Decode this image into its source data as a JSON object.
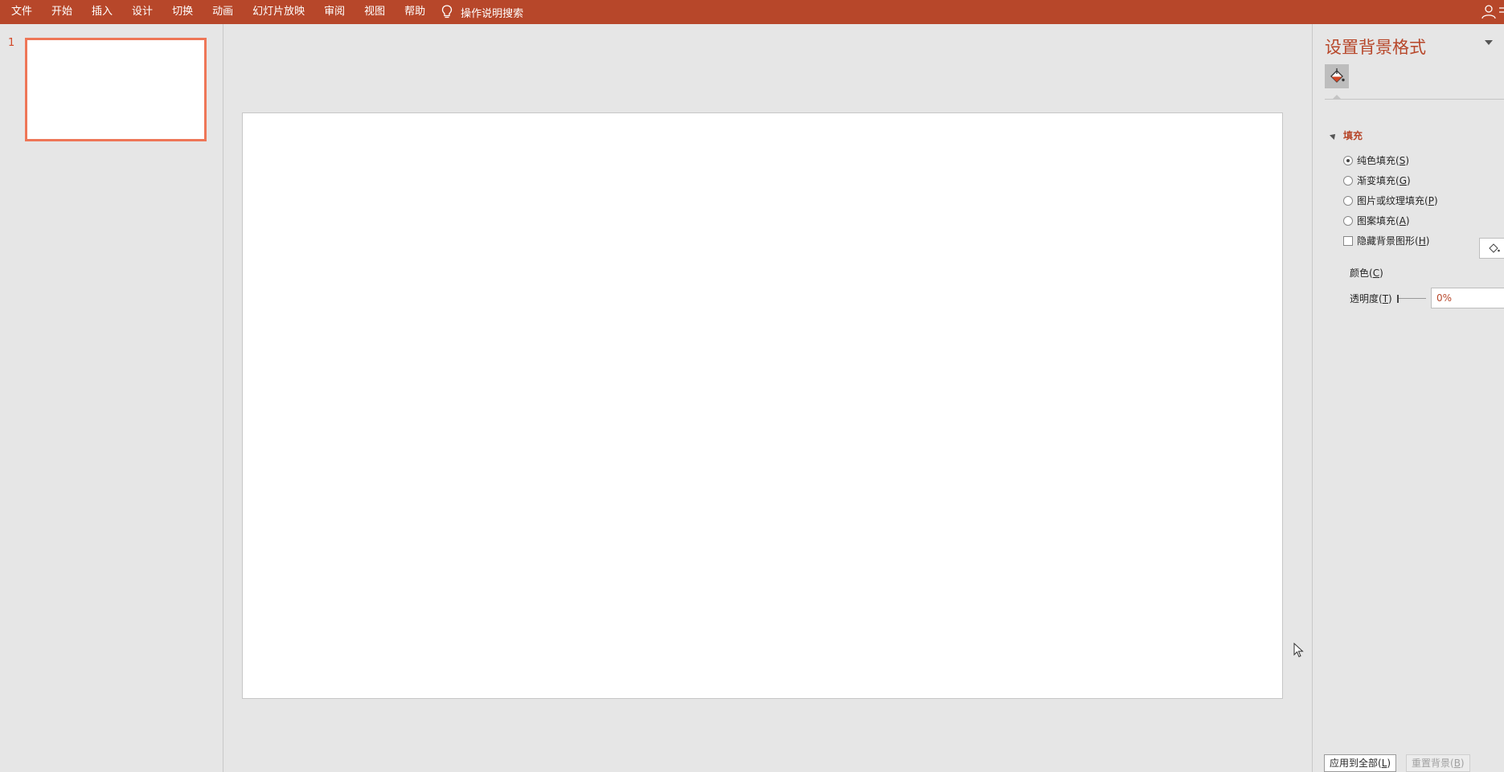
{
  "ribbon": {
    "tabs": [
      "文件",
      "开始",
      "插入",
      "设计",
      "切换",
      "动画",
      "幻灯片放映",
      "审阅",
      "视图",
      "帮助"
    ],
    "tell_me": "操作说明搜索"
  },
  "thumbnails": {
    "slide_number": "1"
  },
  "format_pane": {
    "title": "设置背景格式",
    "section_fill": "填充",
    "options": {
      "solid": {
        "text": "纯色填充(",
        "key": "S",
        "end": ")"
      },
      "gradient": {
        "text": "渐变填充(",
        "key": "G",
        "end": ")"
      },
      "picture": {
        "text": "图片或纹理填充(",
        "key": "P",
        "end": ")"
      },
      "pattern": {
        "text": "图案填充(",
        "key": "A",
        "end": ")"
      },
      "hide_graphics": {
        "text": "隐藏背景图形(",
        "key": "H",
        "end": ")"
      }
    },
    "color": {
      "text": "颜色(",
      "key": "C",
      "end": ")"
    },
    "transparency": {
      "text": "透明度(",
      "key": "T",
      "end": ")",
      "value": "0%",
      "slider_percent": 0
    },
    "selected_fill": "solid",
    "apply_all": {
      "text": "应用到全部(",
      "key": "L",
      "end": ")"
    },
    "reset": {
      "text": "重置背景(",
      "key": "B",
      "end": ")"
    }
  },
  "colors": {
    "ribbon": "#b7472a",
    "accent_text": "#b7472a",
    "thumb_border": "#ee7657",
    "background": "#e6e6e6"
  }
}
